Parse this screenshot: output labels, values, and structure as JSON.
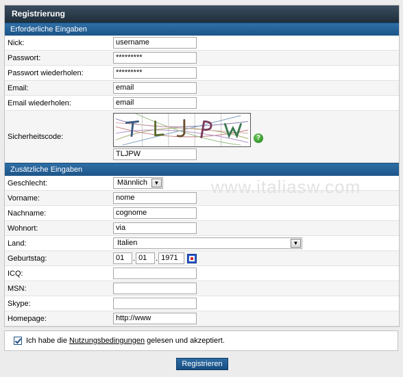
{
  "title": "Registrierung",
  "watermark": "www.italiasw.com",
  "sections": {
    "required": "Erforderliche Eingaben",
    "optional": "Zusätzliche Eingaben"
  },
  "required_fields": {
    "nick": {
      "label": "Nick:",
      "value": "username"
    },
    "password": {
      "label": "Passwort:",
      "value": "*********"
    },
    "password_repeat": {
      "label": "Passwort wiederholen:",
      "value": "*********"
    },
    "email": {
      "label": "Email:",
      "value": "email"
    },
    "email_repeat": {
      "label": "Email wiederholen:",
      "value": "email"
    },
    "captcha": {
      "label": "Sicherheitscode:",
      "value": "TLJPW",
      "image_text": "TLJPW",
      "help_icon": "question-icon"
    }
  },
  "optional_fields": {
    "gender": {
      "label": "Geschlecht:",
      "value": "Männlich"
    },
    "firstname": {
      "label": "Vorname:",
      "value": "nome"
    },
    "lastname": {
      "label": "Nachname:",
      "value": "cognome"
    },
    "city": {
      "label": "Wohnort:",
      "value": "via"
    },
    "country": {
      "label": "Land:",
      "value": "Italien"
    },
    "birthday": {
      "label": "Geburtstag:",
      "day": "01",
      "month": "01",
      "year": "1971",
      "icon": "calendar-icon"
    },
    "icq": {
      "label": "ICQ:",
      "value": ""
    },
    "msn": {
      "label": "MSN:",
      "value": ""
    },
    "skype": {
      "label": "Skype:",
      "value": ""
    },
    "homepage": {
      "label": "Homepage:",
      "value": "http://www"
    }
  },
  "agreement": {
    "checked": true,
    "text_before": "Ich habe die ",
    "link": "Nutzungsbedingungen",
    "text_after": " gelesen und akzeptiert."
  },
  "submit_label": "Registrieren",
  "colors": {
    "title_bar": "#2a3b4a",
    "section_bar": "#2663a0",
    "button": "#21609a"
  }
}
